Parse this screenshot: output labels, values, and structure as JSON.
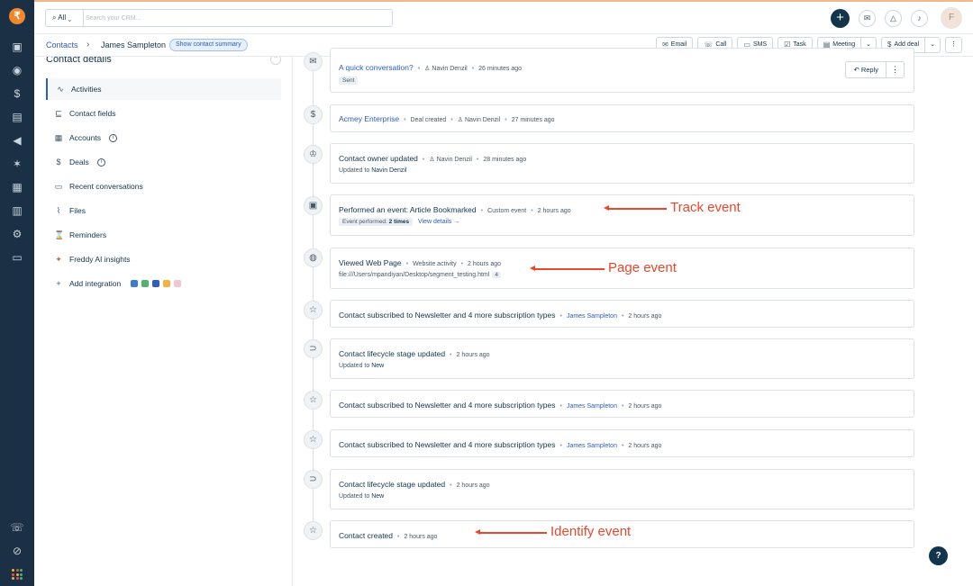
{
  "nav": {
    "logo": "₹",
    "icons": [
      "dashboard-icon",
      "contacts-icon",
      "deals-icon",
      "conversations-icon",
      "campaigns-icon",
      "automation-icon",
      "reports-icon",
      "analytics-icon",
      "settings-icon",
      "chat-icon"
    ],
    "bottom_icons": [
      "phone-icon",
      "compass-icon",
      "apps-icon"
    ]
  },
  "topbar": {
    "search_scope": "All",
    "search_placeholder": "Search your CRM...",
    "avatar_initial": "F"
  },
  "subbar": {
    "breadcrumb_root": "Contacts",
    "breadcrumb_sep": "›",
    "contact_name": "James Sampleton",
    "summary_button": "Show contact summary",
    "actions": {
      "email": "Email",
      "call": "Call",
      "sms": "SMS",
      "task": "Task",
      "meeting": "Meeting",
      "add_deal": "Add deal"
    }
  },
  "left_panel": {
    "title": "Contact details",
    "items": [
      {
        "label": "Activities",
        "icon": "activity-icon"
      },
      {
        "label": "Contact fields",
        "icon": "fields-icon"
      },
      {
        "label": "Accounts",
        "icon": "accounts-icon"
      },
      {
        "label": "Deals",
        "icon": "deals-icon"
      },
      {
        "label": "Recent conversations",
        "icon": "conversation-icon"
      },
      {
        "label": "Files",
        "icon": "attachment-icon"
      },
      {
        "label": "Reminders",
        "icon": "reminder-icon"
      },
      {
        "label": "Freddy AI insights",
        "icon": "freddy-icon"
      },
      {
        "label": "Add integration",
        "icon": "plus-icon"
      }
    ],
    "info_glyph": "i"
  },
  "timeline": [
    {
      "title": "A quick conversation?",
      "actor": "Navin Denzil",
      "time": "26 minutes ago",
      "tag": "Sent",
      "reply": "Reply"
    },
    {
      "title": "Acmey Enterprise",
      "kind": "Deal created",
      "actor": "Navin Denzil",
      "time": "27 minutes ago"
    },
    {
      "title": "Contact owner updated",
      "actor": "Navin Denzil",
      "time": "28 minutes ago",
      "detail_prefix": "Updated to",
      "detail_value": "Navin Denzil"
    },
    {
      "title": "Performed an event: Article Bookmarked",
      "kind": "Custom event",
      "time": "2 hours ago",
      "detail_prefix": "Event performed:",
      "detail_value": "2 times",
      "link": "View details →"
    },
    {
      "title": "Viewed Web Page",
      "kind": "Website activity",
      "time": "2 hours ago",
      "detail_prefix": "file:///Users/mpandiyan/Desktop/segment_testing.html",
      "count": "4"
    },
    {
      "title": "Contact subscribed to Newsletter and 4 more subscription types",
      "actor": "James Sampleton",
      "time": "2 hours ago"
    },
    {
      "title": "Contact lifecycle stage updated",
      "time": "2 hours ago",
      "detail_prefix": "Updated to",
      "detail_value": "New"
    },
    {
      "title": "Contact subscribed to Newsletter and 4 more subscription types",
      "actor": "James Sampleton",
      "time": "2 hours ago"
    },
    {
      "title": "Contact subscribed to Newsletter and 4 more subscription types",
      "actor": "James Sampleton",
      "time": "2 hours ago"
    },
    {
      "title": "Contact lifecycle stage updated",
      "time": "2 hours ago",
      "detail_prefix": "Updated to",
      "detail_value": "New"
    },
    {
      "title": "Contact created",
      "time": "2 hours ago"
    }
  ],
  "annotations": {
    "track": "Track event",
    "page": "Page event",
    "identify": "Identify event"
  },
  "colors": {
    "nav_bg": "#1b3044",
    "link": "#2c5cc5",
    "annotation": "#e8472c",
    "logo": "#f0892d"
  },
  "help": "?"
}
